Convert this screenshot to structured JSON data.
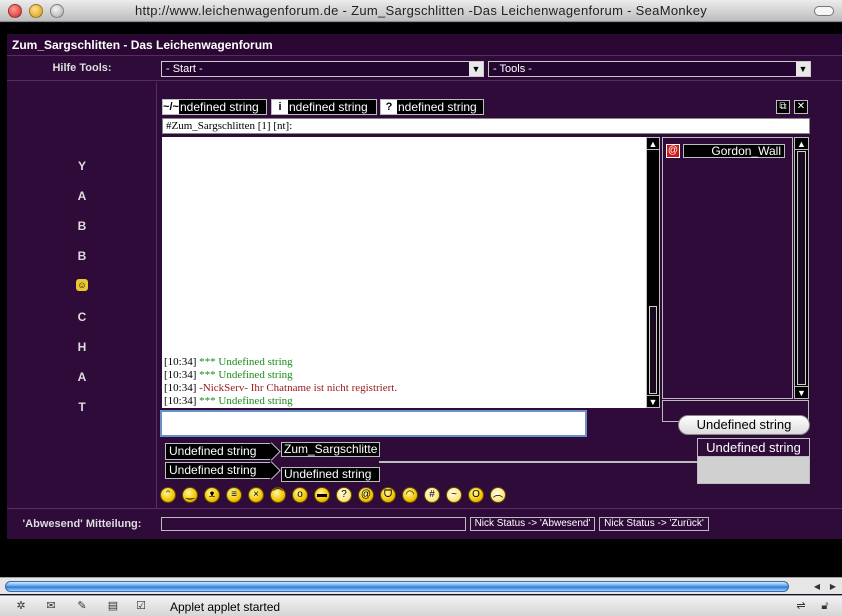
{
  "window": {
    "title": "http://www.leichenwagenforum.de - Zum_Sargschlitten -Das Leichenwagenforum - SeaMonkey"
  },
  "header": {
    "title": "Zum_Sargschlitten - Das Leichenwagenforum"
  },
  "tools": {
    "label": "Hilfe Tools:",
    "start_select": "- Start -",
    "tools_select": "- Tools -"
  },
  "vertical_letters": [
    "Y",
    "A",
    "B",
    "B",
    "C",
    "H",
    "A",
    "T"
  ],
  "top_buttons": [
    {
      "icon": "~/~",
      "label": "ndefined string"
    },
    {
      "icon": "i",
      "label": "ndefined string"
    },
    {
      "icon": "?",
      "label": "ndefined string"
    }
  ],
  "window_buttons": {
    "float": "⧉",
    "close": "✕"
  },
  "channel": {
    "name": "#Zum_Sargschlitten [1] [nt]:"
  },
  "chat_lines": [
    {
      "time": "[10:34]",
      "message": "*** Undefined string",
      "color": "#1a8a1a"
    },
    {
      "time": "[10:34]",
      "message": "*** Undefined string",
      "color": "#1a8a1a"
    },
    {
      "time": "[10:34]",
      "message": "-NickServ- Ihr Chatname ist nicht registriert.",
      "color": "#9a1a1a"
    },
    {
      "time": "[10:34]",
      "message": "*** Undefined string",
      "color": "#1a8a1a"
    }
  ],
  "userlist": {
    "users": [
      {
        "prefix": "@",
        "name": "Gordon_Wall"
      }
    ]
  },
  "input": {
    "value": ""
  },
  "send_button": "Undefined string",
  "arrow_buttons": [
    "Undefined string",
    "Undefined string"
  ],
  "value_boxes": [
    "Zum_Sargschlitte",
    "Undefined string"
  ],
  "status_box": {
    "label": "Undefined string"
  },
  "away": {
    "label": "'Abwesend' Mitteilung:",
    "value": "",
    "button_away": "Nick Status -> 'Abwesend'",
    "button_back": "Nick Status -> 'Zurück'"
  },
  "statusbar": {
    "text": "Applet applet started"
  },
  "colors": {
    "background": "#2e0b38",
    "frame_dark": "#1b0822",
    "accent_scroll": "#2a7ad8"
  }
}
